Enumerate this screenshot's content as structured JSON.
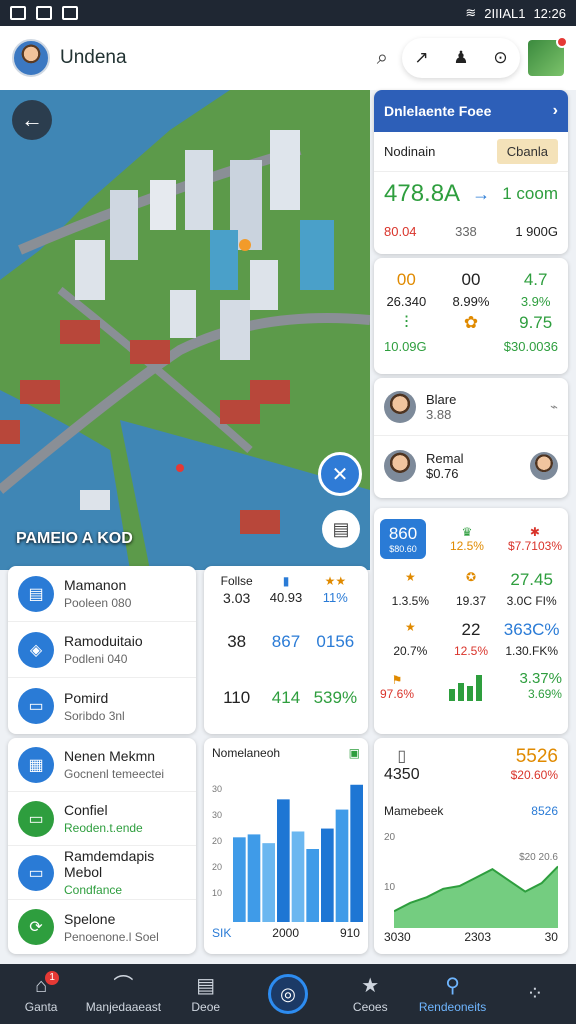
{
  "status_bar": {
    "signal_text": "2IIIAL1",
    "time": "12:26"
  },
  "header": {
    "title": "Undena"
  },
  "map": {
    "label": "PAMEIO A KOD"
  },
  "rc1": {
    "title": "Dnlelaente Foee",
    "sub_label": "Nodinain",
    "tag": "Cbanla",
    "big_left": "478.8A",
    "big_right": "1 coom",
    "foot_left": "80.04",
    "foot_mid": "338",
    "foot_right": "1 900G"
  },
  "rc2": {
    "row1": [
      "00",
      "00",
      "4.7"
    ],
    "row2": [
      "26.340",
      "8.99%",
      "3.9%"
    ],
    "row3_right": "9.75",
    "row4": [
      "10.09G",
      "$30.0036"
    ]
  },
  "rc3": {
    "name1": "Blare",
    "val1": "3.88",
    "name2": "Remal",
    "val2": "$0.76"
  },
  "rc4": {
    "chip": "860",
    "chip_sub": "$80.60",
    "row1_top": [
      "12.5%",
      "$7.7103%"
    ],
    "row2": [
      "1.3.5%",
      "19.37",
      "3.0C FI%"
    ],
    "row2_top": "27.45",
    "row3": [
      "22",
      "363C%"
    ],
    "row3_sub": [
      "20.7%",
      "12.5%",
      "1.30.FK%"
    ],
    "row4_left": "97.6%",
    "row4_right_top": "3.37%",
    "row4_right": "3.69%"
  },
  "rc5": {
    "top_left": "4350",
    "top_right": "5526",
    "top_right_sub": "$20.60%",
    "chart_title": "Mamebeek",
    "chart_value": "8526",
    "chart_x": [
      "3030",
      "2303",
      "30"
    ],
    "chart_y": [
      "20",
      "10"
    ],
    "chart_y_right": "$20 20.6"
  },
  "list1": {
    "items": [
      {
        "title": "Mamanon",
        "sub": "Pooleen 080"
      },
      {
        "title": "Ramoduitaio",
        "sub": "Podleni 040"
      },
      {
        "title": "Pomird",
        "sub": "Soribdo 3nl"
      }
    ]
  },
  "stats": {
    "header": [
      "Follse",
      "3.03",
      "40.93",
      "11%"
    ],
    "row2": [
      "38",
      "867",
      "0156"
    ],
    "row3": [
      "110",
      "414",
      "539%"
    ]
  },
  "list2": {
    "items": [
      {
        "title": "Nenen Mekmn",
        "sub": "Gocnenl temeectei"
      },
      {
        "title": "Confiel",
        "sub": "Reoden.t.ende"
      },
      {
        "title": "Ramdemdapis Mebol",
        "sub": "Condfance"
      },
      {
        "title": "Spelone",
        "sub": "Penoenone.l Soel"
      }
    ]
  },
  "bar_panel": {
    "title": "Nomelaneoh",
    "x_labels": [
      "SIK",
      "2000",
      "910"
    ],
    "y_labels": [
      "30",
      "30",
      "20",
      "20",
      "10"
    ]
  },
  "nav": {
    "items": [
      {
        "label": "Ganta",
        "badge": "1"
      },
      {
        "label": "Manjedaaeast"
      },
      {
        "label": "Deoe"
      },
      {
        "label": ""
      },
      {
        "label": "Ceoes"
      },
      {
        "label": "Rendeoneits"
      },
      {
        "label": ""
      }
    ]
  },
  "chart_data": [
    {
      "type": "bar",
      "title": "Nomelaneoh",
      "categories": [
        "1",
        "2",
        "3",
        "4",
        "5",
        "6",
        "7",
        "8",
        "9"
      ],
      "values": [
        58,
        60,
        54,
        84,
        62,
        50,
        64,
        77,
        94
      ],
      "ylim": [
        0,
        100
      ]
    },
    {
      "type": "area",
      "title": "Mamebeek",
      "x": [
        1,
        2,
        3,
        4,
        5,
        6,
        7,
        8,
        9,
        10,
        11
      ],
      "values": [
        12,
        18,
        22,
        28,
        30,
        36,
        42,
        34,
        26,
        32,
        44
      ],
      "ylim": [
        0,
        60
      ]
    }
  ]
}
